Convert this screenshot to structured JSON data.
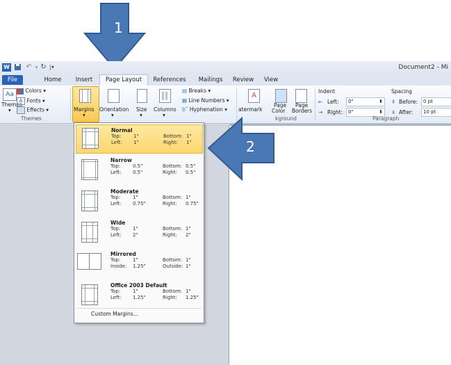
{
  "title_bar": {
    "document_title": "Document2 - Mi",
    "word_logo": "W",
    "save_icon": "save-icon",
    "undo_icon": "undo-icon",
    "redo_icon": "redo-icon"
  },
  "tabs": [
    {
      "label": "File",
      "active": false
    },
    {
      "label": "Home",
      "active": false
    },
    {
      "label": "Insert",
      "active": false
    },
    {
      "label": "Page Layout",
      "active": true
    },
    {
      "label": "References",
      "active": false
    },
    {
      "label": "Mailings",
      "active": false
    },
    {
      "label": "Review",
      "active": false
    },
    {
      "label": "View",
      "active": false
    }
  ],
  "ribbon": {
    "themes": {
      "themes_label": "Themes",
      "colors_label": "Colors",
      "fonts_label": "Fonts",
      "effects_label": "Effects",
      "group_label": "Themes"
    },
    "page_setup": {
      "margins_label": "Margins",
      "orientation_label": "Orientation",
      "size_label": "Size",
      "columns_label": "Columns",
      "breaks_label": "Breaks",
      "line_numbers_label": "Line Numbers",
      "hyphenation_label": "Hyphenation"
    },
    "page_background": {
      "watermark_label": "atermark",
      "page_color_label_1": "Page",
      "page_color_label_2": "Color",
      "page_borders_label_1": "Page",
      "page_borders_label_2": "Borders",
      "group_label": "kground"
    },
    "paragraph": {
      "indent_header": "Indent",
      "left_label": "Left:",
      "left_value": "0\"",
      "right_label": "Right:",
      "right_value": "0\"",
      "spacing_header": "Spacing",
      "before_label": "Before:",
      "before_value": "0 pt",
      "after_label": "After:",
      "after_value": "10 pt",
      "group_label": "Paragraph"
    }
  },
  "margins_menu": {
    "items": [
      {
        "name": "Normal",
        "r1l": "Top:",
        "r1v": "1\"",
        "r1l2": "Bottom:",
        "r1v2": "1\"",
        "r2l": "Left:",
        "r2v": "1\"",
        "r2l2": "Right:",
        "r2v2": "1\""
      },
      {
        "name": "Narrow",
        "r1l": "Top:",
        "r1v": "0.5\"",
        "r1l2": "Bottom:",
        "r1v2": "0.5\"",
        "r2l": "Left:",
        "r2v": "0.5\"",
        "r2l2": "Right:",
        "r2v2": "0.5\""
      },
      {
        "name": "Moderate",
        "r1l": "Top:",
        "r1v": "1\"",
        "r1l2": "Bottom:",
        "r1v2": "1\"",
        "r2l": "Left:",
        "r2v": "0.75\"",
        "r2l2": "Right:",
        "r2v2": "0.75\""
      },
      {
        "name": "Wide",
        "r1l": "Top:",
        "r1v": "1\"",
        "r1l2": "Bottom:",
        "r1v2": "1\"",
        "r2l": "Left:",
        "r2v": "2\"",
        "r2l2": "Right:",
        "r2v2": "2\""
      },
      {
        "name": "Mirrored",
        "r1l": "Top:",
        "r1v": "1\"",
        "r1l2": "Bottom:",
        "r1v2": "1\"",
        "r2l": "Inside:",
        "r2v": "1.25\"",
        "r2l2": "Outside:",
        "r2v2": "1\""
      },
      {
        "name": "Office 2003 Default",
        "r1l": "Top:",
        "r1v": "1\"",
        "r1l2": "Bottom:",
        "r1v2": "1\"",
        "r2l": "Left:",
        "r2v": "1.25\"",
        "r2l2": "Right:",
        "r2v2": "1.25\""
      }
    ],
    "selected": "Normal",
    "custom_label": "Custom Margins..."
  },
  "annotations": {
    "step1": "1",
    "step2": "2",
    "arrow_color": "#4a78b5"
  }
}
